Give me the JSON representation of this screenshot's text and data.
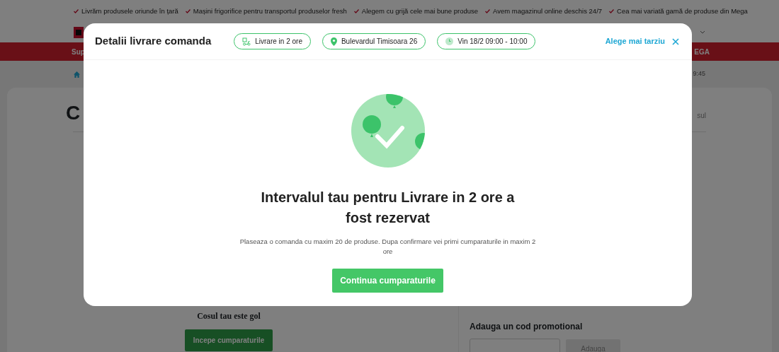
{
  "top_strip": {
    "items": [
      "Livrăm produsele oriunde în țară",
      "Mașini frigorifice pentru transportul produselor fresh",
      "Alegem cu grijă cele mai bune produse",
      "Avem magazinul online deschis 24/7",
      "Cea mai variată gamă de produse din Mega"
    ]
  },
  "nav_bar": {
    "left_text": "Sup",
    "right_text": "EGA"
  },
  "breadcrumb": {
    "time": "9:45"
  },
  "page_title": "C",
  "cart_link": "sul",
  "empty_cart": {
    "message": "Cosul tau este gol",
    "button": "Incepe cumparaturile"
  },
  "promo": {
    "title": "Adauga un cod promotional",
    "button": "Adauga"
  },
  "modal": {
    "title": "Detalii livrare comanda",
    "pills": [
      {
        "kind": "delivery",
        "label": "Livrare in 2 ore"
      },
      {
        "kind": "address",
        "label": "Bulevardul Timisoara 26"
      },
      {
        "kind": "time",
        "label": "Vin 18/2 09:00 - 10:00"
      }
    ],
    "later_link": "Alege mai tarziu",
    "heading": "Intervalul tau pentru Livrare in 2 ore a fost rezervat",
    "text": "Plaseaza o comanda cu maxim 20 de produse. Dupa confirmare vei primi cumparaturile in maxim 2 ore",
    "button": "Continua cumparaturile"
  }
}
